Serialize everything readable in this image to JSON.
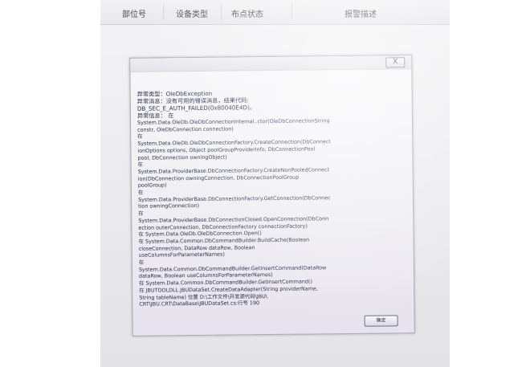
{
  "table": {
    "columns": [
      "部位号",
      "设备类型",
      "布点状态",
      "报警描述"
    ]
  },
  "dialog": {
    "close_label": "X",
    "ok_label": "确定",
    "lines": [
      "异常类型：OleDbException",
      "异常消息：没有可用的错误消息，结果代码:",
      "DB_SEC_E_AUTH_FAILED(0x80040E4D)。",
      "异常信息：  在",
      "System.Data.OleDb.OleDbConnectionInternal..ctor(OleDbConnectionString",
      "constr, OleDbConnection connection)",
      "  在",
      "System.Data.OleDb.OleDbConnectionFactory.CreateConnection(DbConnect",
      "ionOptions options, Object poolGroupProviderInfo, DbConnectionPool",
      "pool, DbConnection owningObject)",
      "  在",
      "System.Data.ProviderBase.DbConnectionFactory.CreateNonPooledConnect",
      "ion(DbConnection owningConnection, DbConnectionPoolGroup",
      "poolGroup)",
      "  在",
      "System.Data.ProviderBase.DbConnectionFactory.GetConnection(DbConnec",
      "tion owningConnection)",
      "  在",
      "System.Data.ProviderBase.DbConnectionClosed.OpenConnection(DbConn",
      "ection outerConnection, DbConnectionFactory connectionFactory)",
      "  在 System.Data.OleDb.OleDbConnection.Open()",
      "  在 System.Data.Common.DbCommandBuilder.BuildCache(Boolean",
      "closeConnection, DataRow dataRow, Boolean",
      "useColumnsForParameterNames)",
      "  在",
      "System.Data.Common.DbCommandBuilder.GetInsertCommand(DataRow",
      "dataRow, Boolean useColumnsForParameterNames)",
      "  在 System.Data.Common.DbCommandBuilder.GetInsertCommand()",
      "  在 JBUTOOLDLL.JBUDataSet.CreateDataAdapter(String providerName,",
      "String tableName) 位置 D:\\工作文件\\开发源代码\\JBU\\",
      "CRT\\JBU.CRT\\DataBase\\JBUDataSet.cs:行号 190"
    ]
  }
}
